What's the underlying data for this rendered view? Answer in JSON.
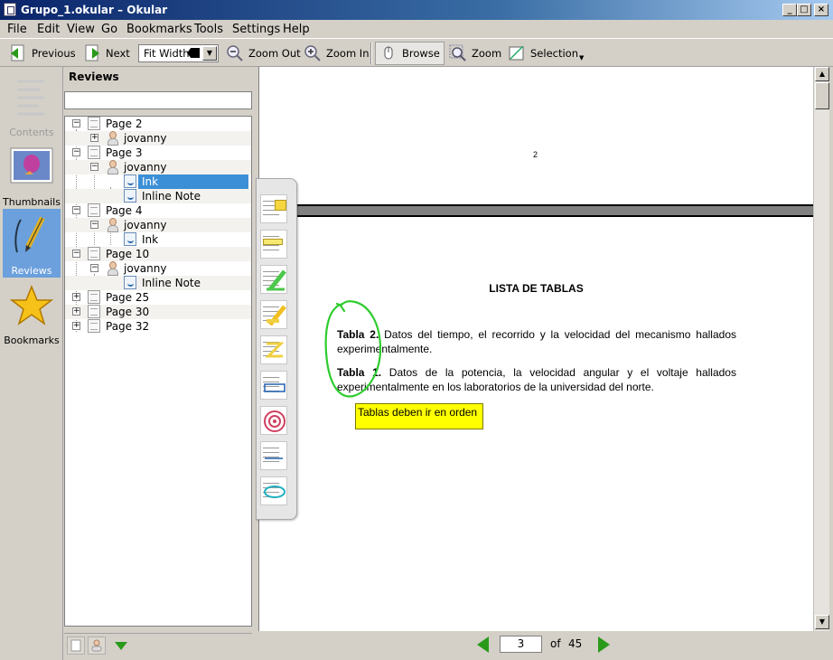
{
  "window": {
    "title": "Grupo_1.okular – Okular"
  },
  "menu": [
    "File",
    "Edit",
    "View",
    "Go",
    "Bookmarks",
    "Tools",
    "Settings",
    "Help"
  ],
  "toolbar": {
    "previous": "Previous",
    "next": "Next",
    "zoom_mode": "Fit Width",
    "zoom_out": "Zoom Out",
    "zoom_in": "Zoom In",
    "browse": "Browse",
    "zoom": "Zoom",
    "selection": "Selection"
  },
  "sidebar": {
    "items": [
      {
        "label": "Contents",
        "icon": "contents-icon",
        "state": "disabled"
      },
      {
        "label": "Thumbnails",
        "icon": "thumbnails-icon",
        "state": "normal"
      },
      {
        "label": "Reviews",
        "icon": "reviews-pencil-icon",
        "state": "active"
      },
      {
        "label": "Bookmarks",
        "icon": "bookmarks-star-icon",
        "state": "normal"
      }
    ]
  },
  "reviews": {
    "title": "Reviews",
    "search_placeholder": "",
    "tree": [
      {
        "label": "Page 2",
        "type": "page",
        "expanded": true
      },
      {
        "label": "jovanny",
        "type": "author",
        "expanded": false
      },
      {
        "label": "Page 3",
        "type": "page",
        "expanded": true
      },
      {
        "label": "jovanny",
        "type": "author",
        "expanded": true
      },
      {
        "label": "Ink",
        "type": "annotation",
        "selected": true
      },
      {
        "label": "Inline Note",
        "type": "annotation"
      },
      {
        "label": "Page 4",
        "type": "page",
        "expanded": true
      },
      {
        "label": "jovanny",
        "type": "author",
        "expanded": true
      },
      {
        "label": "Ink",
        "type": "annotation"
      },
      {
        "label": "Page 10",
        "type": "page",
        "expanded": true
      },
      {
        "label": "jovanny",
        "type": "author",
        "expanded": true
      },
      {
        "label": "Inline Note",
        "type": "annotation"
      },
      {
        "label": "Page 25",
        "type": "page",
        "expanded": false
      },
      {
        "label": "Page 30",
        "type": "page",
        "expanded": false
      },
      {
        "label": "Page 32",
        "type": "page",
        "expanded": false
      }
    ]
  },
  "annotation_tools": [
    "pop-up-note-tool",
    "inline-note-tool",
    "green-ink-tool",
    "yellow-highlighter-tool",
    "yellow-ink-tool",
    "straight-line-tool",
    "stamp-tool",
    "underline-tool",
    "ellipse-tool"
  ],
  "document": {
    "top_page_number": "2",
    "heading": "LISTA DE TABLAS",
    "tables": [
      {
        "label": "Tabla 2.",
        "text": "Datos del tiempo, el recorrido y la velocidad del mecanismo hallados experimentalmente."
      },
      {
        "label": "Tabla 1.",
        "text": "Datos de la potencia, la velocidad angular y el voltaje hallados experimentalmente en los laboratorios de la universidad del norte."
      }
    ],
    "inline_note": "Tablas deben ir en orden"
  },
  "pager": {
    "current": "3",
    "of_label": "of",
    "total": "45"
  },
  "colors": {
    "accent": "#3b8fd6",
    "ink": "#2ecc2e",
    "note": "#ffff00",
    "nav_arrow": "#2a9a1a"
  }
}
